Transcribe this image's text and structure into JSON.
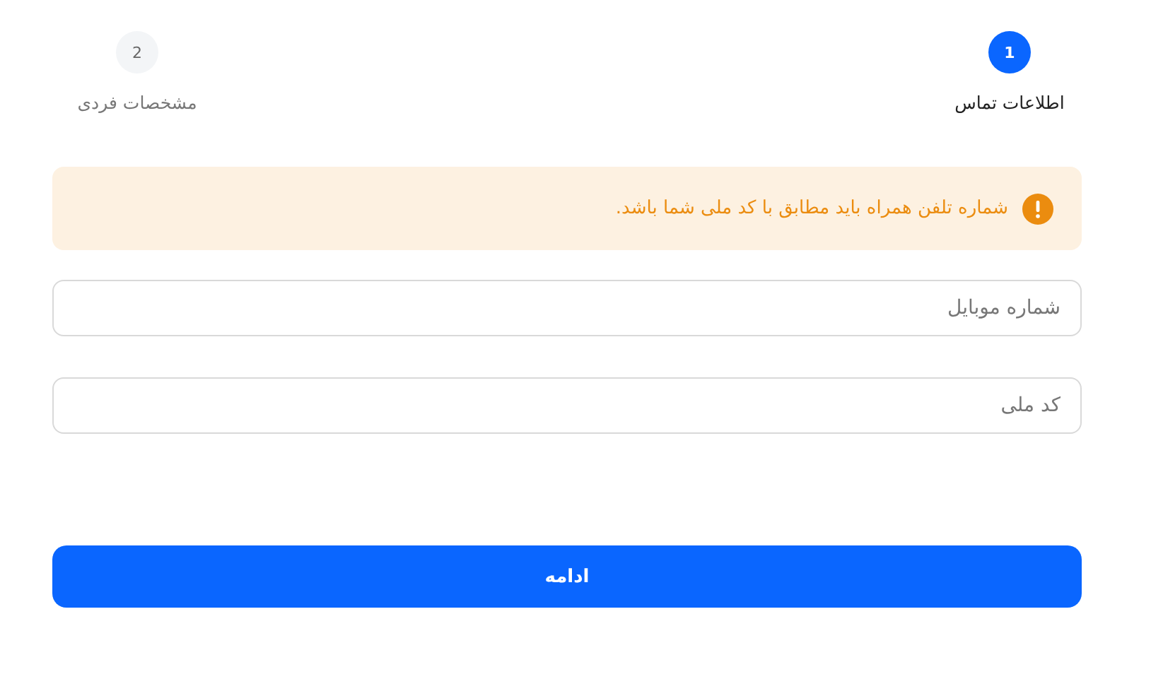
{
  "steps": [
    {
      "number": "1",
      "label": "اطلاعات تماس",
      "selected": true
    },
    {
      "number": "2",
      "label": "مشخصات فردی",
      "selected": false
    }
  ],
  "alert": {
    "kind": "warning",
    "text": "شماره تلفن همراه باید مطابق با کد ملی شما باشد."
  },
  "fields": [
    {
      "placeholder": "شماره موبایل"
    },
    {
      "placeholder": "کد ملی"
    }
  ],
  "submit_button": {
    "label": "ادامه"
  }
}
